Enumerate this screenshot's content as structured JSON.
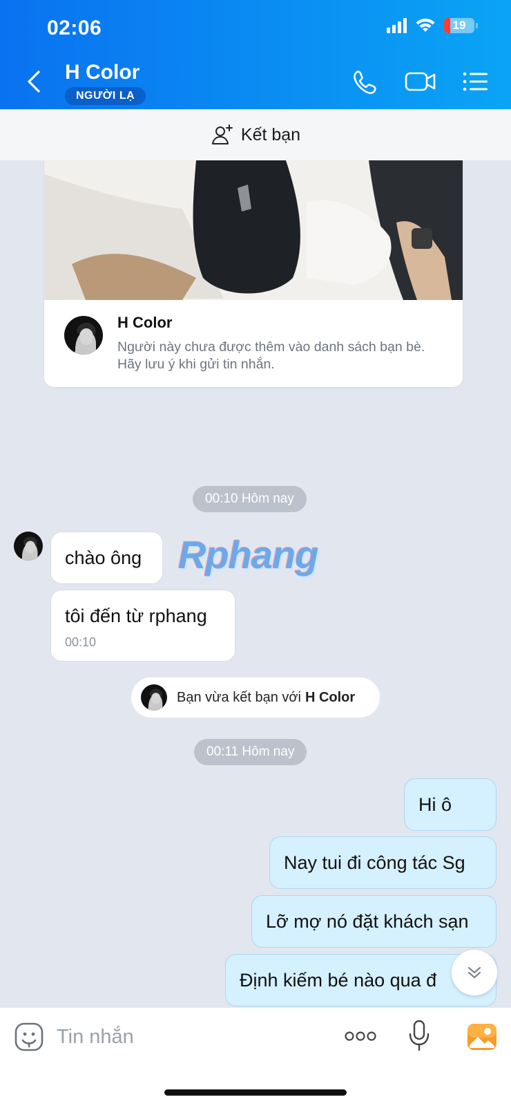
{
  "status_bar": {
    "time": "02:06",
    "battery": "19"
  },
  "header": {
    "name": "H Color",
    "badge": "NGƯỜI LẠ"
  },
  "add_friend": {
    "label": "Kết bạn"
  },
  "profile_card": {
    "name": "H Color",
    "note": "Người này chưa được thêm vào danh sách bạn bè. Hãy lưu ý khi gửi tin nhắn."
  },
  "watermark": "Rphang",
  "messages": {
    "time_chip_1": "00:10 Hôm nay",
    "incoming": [
      {
        "text": "chào ông"
      },
      {
        "text": "tôi đến từ rphang",
        "time": "00:10"
      }
    ],
    "friend_notice": {
      "prefix": "Bạn vừa kết bạn với",
      "name": "H Color"
    },
    "time_chip_2": "00:11 Hôm nay",
    "outgoing": [
      {
        "text": "Hi ô"
      },
      {
        "text": "Nay tui đi công tác Sg"
      },
      {
        "text": "Lỡ mợ nó đặt khách sạn"
      },
      {
        "text": "Định kiếm bé nào qua đ"
      }
    ]
  },
  "composer": {
    "placeholder": "Tin nhắn"
  },
  "colors": {
    "header_start": "#0a72f0",
    "header_end": "#0aa4f5",
    "outgoing_bubble": "#d5f0fe",
    "background": "#e2e7ef"
  },
  "icons": [
    "back-icon",
    "phone-icon",
    "video-call-icon",
    "menu-icon",
    "add-friend-icon",
    "emoji-icon",
    "more-icon",
    "mic-icon",
    "photo-icon",
    "chevron-double-down-icon"
  ]
}
